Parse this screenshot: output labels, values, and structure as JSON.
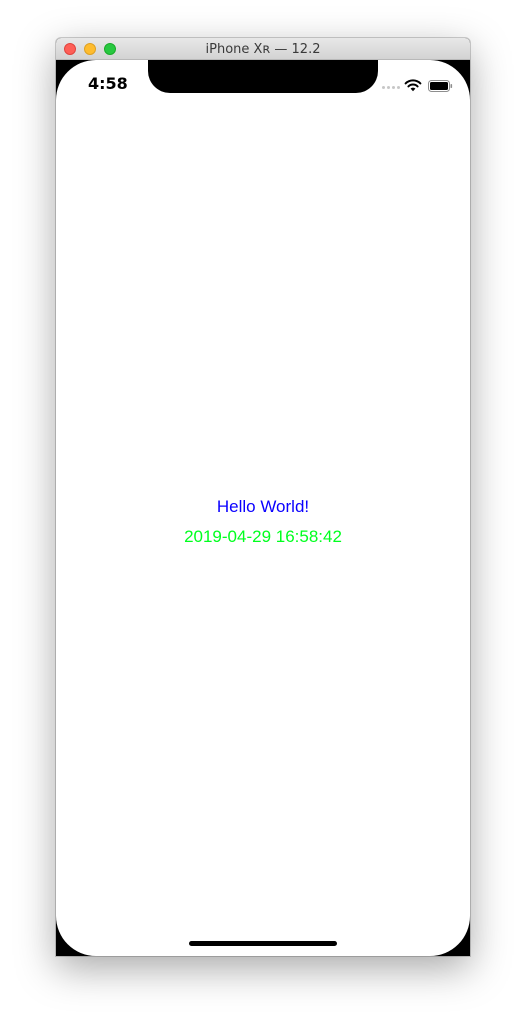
{
  "window": {
    "title": "iPhone Xʀ — 12.2"
  },
  "status_bar": {
    "time": "4:58",
    "icons": [
      "cellular-signal-icon",
      "wifi-icon",
      "battery-icon"
    ]
  },
  "content": {
    "hello_text": "Hello World!",
    "hello_color": "#0a00ff",
    "date_text": "2019-04-29 16:58:42",
    "date_color": "#00ff1e"
  },
  "colors": {
    "close": "#fe5f57",
    "minimize": "#febc2e",
    "maximize": "#28c840"
  }
}
